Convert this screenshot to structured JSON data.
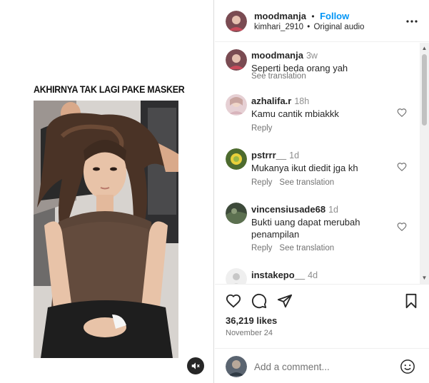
{
  "video": {
    "caption": "AKHIRNYA TAK LAGI PAKE MASKER"
  },
  "post_header": {
    "username": "moodmanja",
    "separator": "•",
    "follow_label": "Follow",
    "audio_user": "kimhari_2910",
    "audio_separator": "•",
    "audio_label": "Original audio"
  },
  "comments": [
    {
      "username": "moodmanja",
      "time": "3w",
      "text": "Seperti beda orang yah",
      "meta": [
        "See translation"
      ],
      "liked_icon": false
    },
    {
      "username": "azhalifa.r",
      "time": "18h",
      "text": "Kamu cantik mbiakkk",
      "meta": [
        "Reply"
      ],
      "liked_icon": true
    },
    {
      "username": "pstrrr__",
      "time": "1d",
      "text": "Mukanya ikut diedit jga kh",
      "meta": [
        "Reply",
        "See translation"
      ],
      "liked_icon": true
    },
    {
      "username": "vincensiusade68",
      "time": "1d",
      "text": "Bukti uang dapat merubah penampilan",
      "meta": [
        "Reply",
        "See translation"
      ],
      "liked_icon": true
    },
    {
      "username": "instakepo__",
      "time": "4d",
      "text": "",
      "meta": [],
      "liked_icon": false
    }
  ],
  "actions": {
    "likes": "36,219 likes",
    "date": "November 24"
  },
  "add_comment": {
    "placeholder": "Add a comment..."
  },
  "colors": {
    "accent": "#0095f6",
    "text": "#262626",
    "secondary": "#737373",
    "divider": "#efefef"
  }
}
